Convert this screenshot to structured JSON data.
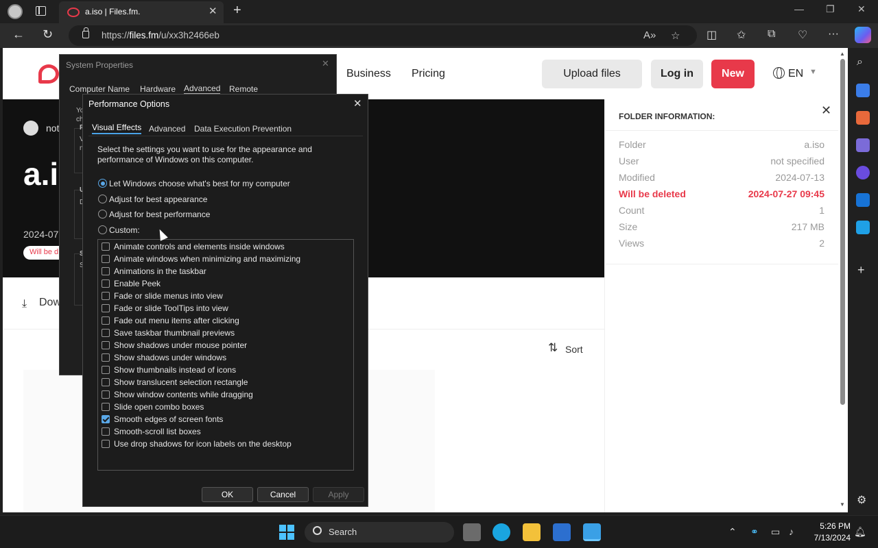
{
  "browser": {
    "tab_title": "a.iso | Files.fm.",
    "url_prefix": "https://",
    "url_domain": "files.fm",
    "url_path": "/u/xx3h2466eb"
  },
  "site": {
    "nav": [
      "Business",
      "Pricing"
    ],
    "upload_label": "Upload files",
    "login_label": "Log in",
    "new_label": "New",
    "lang": "EN",
    "user_fragment": "not",
    "title_fragment": "a.i",
    "date_fragment": "2024-07",
    "badge_fragment": "Will be d",
    "download_fragment": "Dow",
    "sort_label": "Sort"
  },
  "info_panel": {
    "title": "FOLDER INFORMATION:",
    "rows": [
      {
        "label": "Folder",
        "value": "a.iso"
      },
      {
        "label": "User",
        "value": "not specified"
      },
      {
        "label": "Modified",
        "value": "2024-07-13"
      },
      {
        "label": "Will be deleted",
        "value": "2024-07-27 09:45"
      },
      {
        "label": "Count",
        "value": "1"
      },
      {
        "label": "Size",
        "value": "217 MB"
      },
      {
        "label": "Views",
        "value": "2"
      }
    ]
  },
  "system_properties": {
    "title": "System Properties",
    "tabs": [
      "Computer Name",
      "Hardware",
      "Advanced",
      "Remote"
    ],
    "active_tab": "Advanced",
    "fragments": [
      "Yo",
      "ch",
      "P",
      "V",
      "n",
      "U",
      "D",
      "S",
      "S"
    ]
  },
  "performance_options": {
    "title": "Performance Options",
    "tabs": [
      "Visual Effects",
      "Advanced",
      "Data Execution Prevention"
    ],
    "active_tab": "Visual Effects",
    "description": "Select the settings you want to use for the appearance and performance of Windows on this computer.",
    "radios": [
      {
        "label": "Let Windows choose what's best for my computer",
        "checked": true
      },
      {
        "label": "Adjust for best appearance",
        "checked": false
      },
      {
        "label": "Adjust for best performance",
        "checked": false
      },
      {
        "label": "Custom:",
        "checked": false
      }
    ],
    "effects": [
      {
        "label": "Animate controls and elements inside windows",
        "checked": false
      },
      {
        "label": "Animate windows when minimizing and maximizing",
        "checked": false
      },
      {
        "label": "Animations in the taskbar",
        "checked": false
      },
      {
        "label": "Enable Peek",
        "checked": false
      },
      {
        "label": "Fade or slide menus into view",
        "checked": false
      },
      {
        "label": "Fade or slide ToolTips into view",
        "checked": false
      },
      {
        "label": "Fade out menu items after clicking",
        "checked": false
      },
      {
        "label": "Save taskbar thumbnail previews",
        "checked": false
      },
      {
        "label": "Show shadows under mouse pointer",
        "checked": false
      },
      {
        "label": "Show shadows under windows",
        "checked": false
      },
      {
        "label": "Show thumbnails instead of icons",
        "checked": false
      },
      {
        "label": "Show translucent selection rectangle",
        "checked": false
      },
      {
        "label": "Show window contents while dragging",
        "checked": false
      },
      {
        "label": "Slide open combo boxes",
        "checked": false
      },
      {
        "label": "Smooth edges of screen fonts",
        "checked": true
      },
      {
        "label": "Smooth-scroll list boxes",
        "checked": false
      },
      {
        "label": "Use drop shadows for icon labels on the desktop",
        "checked": false
      }
    ],
    "buttons": {
      "ok": "OK",
      "cancel": "Cancel",
      "apply": "Apply"
    }
  },
  "taskbar": {
    "search_label": "Search",
    "time": "5:26 PM",
    "date": "7/13/2024"
  },
  "colors": {
    "brand_red": "#e8394a",
    "accent_blue": "#5aa8e8"
  }
}
